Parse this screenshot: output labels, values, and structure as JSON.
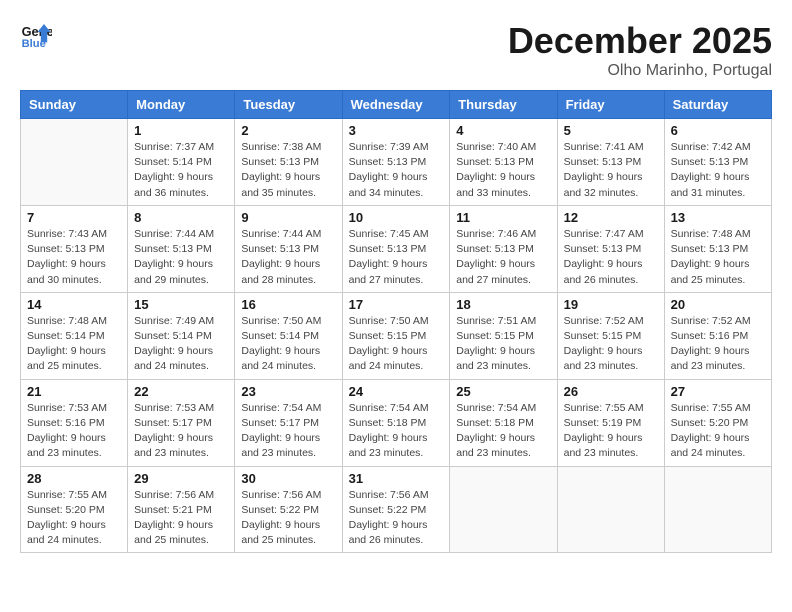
{
  "logo": {
    "line1": "General",
    "line2": "Blue"
  },
  "title": "December 2025",
  "subtitle": "Olho Marinho, Portugal",
  "days_of_week": [
    "Sunday",
    "Monday",
    "Tuesday",
    "Wednesday",
    "Thursday",
    "Friday",
    "Saturday"
  ],
  "weeks": [
    [
      {
        "day": "",
        "info": ""
      },
      {
        "day": "1",
        "info": "Sunrise: 7:37 AM\nSunset: 5:14 PM\nDaylight: 9 hours\nand 36 minutes."
      },
      {
        "day": "2",
        "info": "Sunrise: 7:38 AM\nSunset: 5:13 PM\nDaylight: 9 hours\nand 35 minutes."
      },
      {
        "day": "3",
        "info": "Sunrise: 7:39 AM\nSunset: 5:13 PM\nDaylight: 9 hours\nand 34 minutes."
      },
      {
        "day": "4",
        "info": "Sunrise: 7:40 AM\nSunset: 5:13 PM\nDaylight: 9 hours\nand 33 minutes."
      },
      {
        "day": "5",
        "info": "Sunrise: 7:41 AM\nSunset: 5:13 PM\nDaylight: 9 hours\nand 32 minutes."
      },
      {
        "day": "6",
        "info": "Sunrise: 7:42 AM\nSunset: 5:13 PM\nDaylight: 9 hours\nand 31 minutes."
      }
    ],
    [
      {
        "day": "7",
        "info": "Sunrise: 7:43 AM\nSunset: 5:13 PM\nDaylight: 9 hours\nand 30 minutes."
      },
      {
        "day": "8",
        "info": "Sunrise: 7:44 AM\nSunset: 5:13 PM\nDaylight: 9 hours\nand 29 minutes."
      },
      {
        "day": "9",
        "info": "Sunrise: 7:44 AM\nSunset: 5:13 PM\nDaylight: 9 hours\nand 28 minutes."
      },
      {
        "day": "10",
        "info": "Sunrise: 7:45 AM\nSunset: 5:13 PM\nDaylight: 9 hours\nand 27 minutes."
      },
      {
        "day": "11",
        "info": "Sunrise: 7:46 AM\nSunset: 5:13 PM\nDaylight: 9 hours\nand 27 minutes."
      },
      {
        "day": "12",
        "info": "Sunrise: 7:47 AM\nSunset: 5:13 PM\nDaylight: 9 hours\nand 26 minutes."
      },
      {
        "day": "13",
        "info": "Sunrise: 7:48 AM\nSunset: 5:13 PM\nDaylight: 9 hours\nand 25 minutes."
      }
    ],
    [
      {
        "day": "14",
        "info": "Sunrise: 7:48 AM\nSunset: 5:14 PM\nDaylight: 9 hours\nand 25 minutes."
      },
      {
        "day": "15",
        "info": "Sunrise: 7:49 AM\nSunset: 5:14 PM\nDaylight: 9 hours\nand 24 minutes."
      },
      {
        "day": "16",
        "info": "Sunrise: 7:50 AM\nSunset: 5:14 PM\nDaylight: 9 hours\nand 24 minutes."
      },
      {
        "day": "17",
        "info": "Sunrise: 7:50 AM\nSunset: 5:15 PM\nDaylight: 9 hours\nand 24 minutes."
      },
      {
        "day": "18",
        "info": "Sunrise: 7:51 AM\nSunset: 5:15 PM\nDaylight: 9 hours\nand 23 minutes."
      },
      {
        "day": "19",
        "info": "Sunrise: 7:52 AM\nSunset: 5:15 PM\nDaylight: 9 hours\nand 23 minutes."
      },
      {
        "day": "20",
        "info": "Sunrise: 7:52 AM\nSunset: 5:16 PM\nDaylight: 9 hours\nand 23 minutes."
      }
    ],
    [
      {
        "day": "21",
        "info": "Sunrise: 7:53 AM\nSunset: 5:16 PM\nDaylight: 9 hours\nand 23 minutes."
      },
      {
        "day": "22",
        "info": "Sunrise: 7:53 AM\nSunset: 5:17 PM\nDaylight: 9 hours\nand 23 minutes."
      },
      {
        "day": "23",
        "info": "Sunrise: 7:54 AM\nSunset: 5:17 PM\nDaylight: 9 hours\nand 23 minutes."
      },
      {
        "day": "24",
        "info": "Sunrise: 7:54 AM\nSunset: 5:18 PM\nDaylight: 9 hours\nand 23 minutes."
      },
      {
        "day": "25",
        "info": "Sunrise: 7:54 AM\nSunset: 5:18 PM\nDaylight: 9 hours\nand 23 minutes."
      },
      {
        "day": "26",
        "info": "Sunrise: 7:55 AM\nSunset: 5:19 PM\nDaylight: 9 hours\nand 23 minutes."
      },
      {
        "day": "27",
        "info": "Sunrise: 7:55 AM\nSunset: 5:20 PM\nDaylight: 9 hours\nand 24 minutes."
      }
    ],
    [
      {
        "day": "28",
        "info": "Sunrise: 7:55 AM\nSunset: 5:20 PM\nDaylight: 9 hours\nand 24 minutes."
      },
      {
        "day": "29",
        "info": "Sunrise: 7:56 AM\nSunset: 5:21 PM\nDaylight: 9 hours\nand 25 minutes."
      },
      {
        "day": "30",
        "info": "Sunrise: 7:56 AM\nSunset: 5:22 PM\nDaylight: 9 hours\nand 25 minutes."
      },
      {
        "day": "31",
        "info": "Sunrise: 7:56 AM\nSunset: 5:22 PM\nDaylight: 9 hours\nand 26 minutes."
      },
      {
        "day": "",
        "info": ""
      },
      {
        "day": "",
        "info": ""
      },
      {
        "day": "",
        "info": ""
      }
    ]
  ]
}
